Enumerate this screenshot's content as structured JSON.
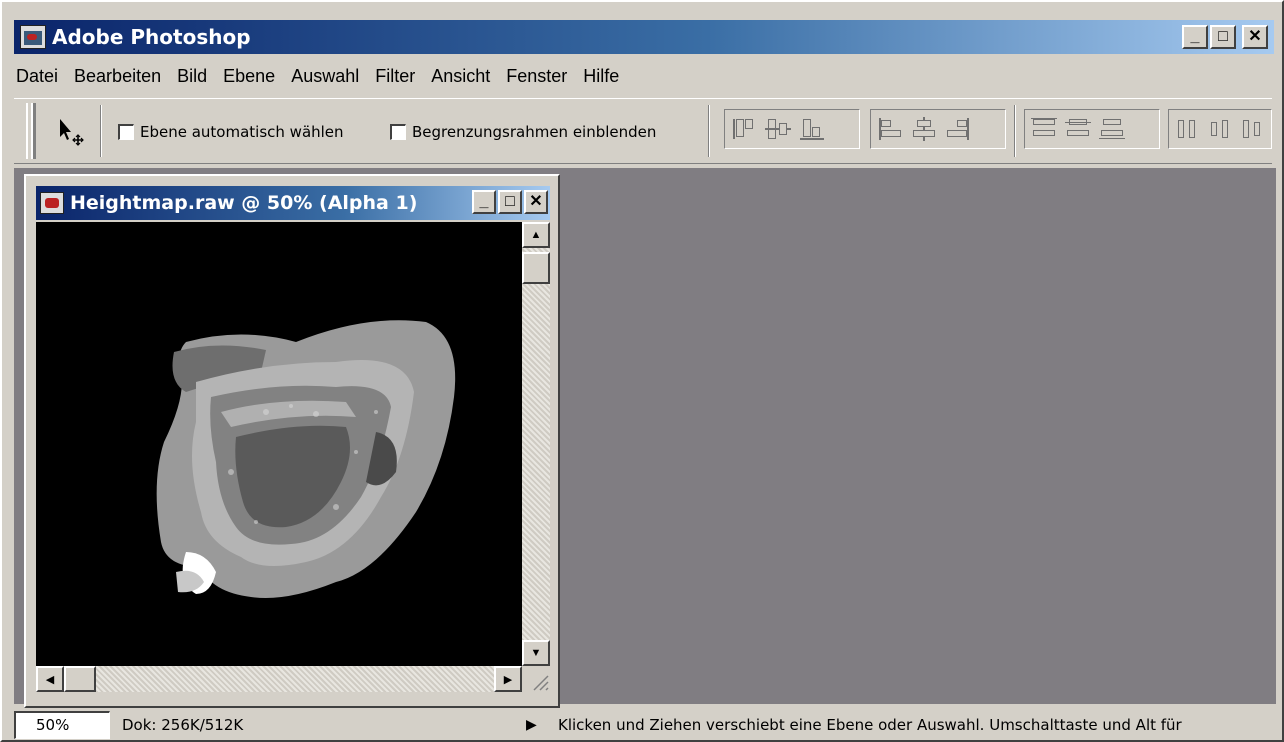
{
  "app": {
    "title": "Adobe Photoshop"
  },
  "window_controls": {
    "minimize": "_",
    "maximize": "□",
    "close": "✕"
  },
  "menu": [
    "Datei",
    "Bearbeiten",
    "Bild",
    "Ebene",
    "Auswahl",
    "Filter",
    "Ansicht",
    "Fenster",
    "Hilfe"
  ],
  "options": {
    "tool_icon": "move-tool-icon",
    "auto_select_label": "Ebene automatisch wählen",
    "bounding_box_label": "Begrenzungsrahmen einblenden",
    "auto_select_checked": false,
    "bounding_box_checked": false
  },
  "document": {
    "title": "Heightmap.raw @ 50% (Alpha 1)",
    "canvas_color": "#000000"
  },
  "status": {
    "zoom": "50%",
    "doc_info": "Dok: 256K/512K",
    "message": "Klicken und Ziehen verschiebt eine Ebene oder Auswahl. Umschalttaste und Alt für"
  },
  "colors": {
    "titlebar_start": "#0a246a",
    "titlebar_end": "#a6caf0",
    "workspace": "#807d82",
    "chrome": "#d4d0c8"
  }
}
